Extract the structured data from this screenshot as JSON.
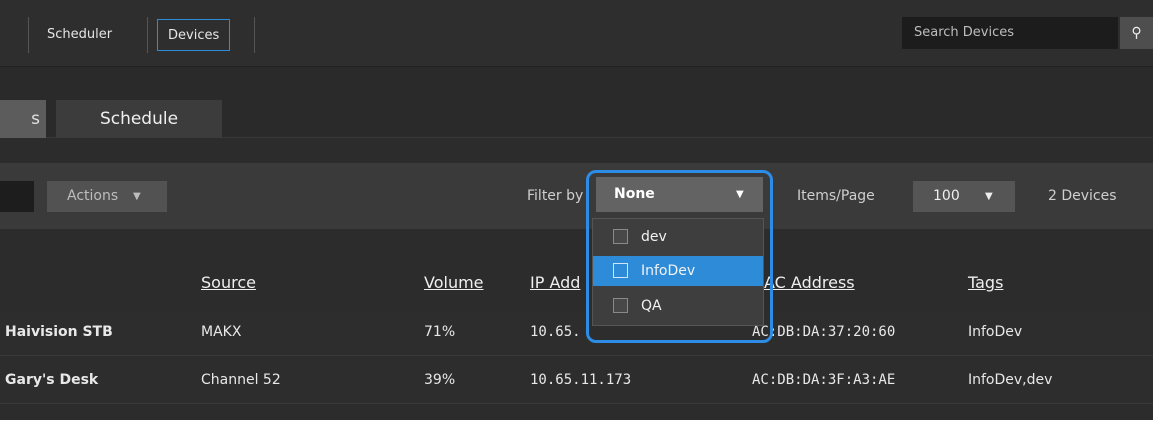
{
  "nav": {
    "tabs": [
      "Scheduler",
      "Devices"
    ],
    "active_tab": "Devices",
    "search_placeholder": "Search Devices",
    "search_icon": "search-icon"
  },
  "subtabs": {
    "left_label": "s",
    "schedule_label": "Schedule"
  },
  "toolbar": {
    "actions_label": "Actions",
    "filter_label": "Filter by",
    "filter_value": "None",
    "items_per_page_label": "Items/Page",
    "items_per_page_value": "100",
    "device_count": "2 Devices"
  },
  "filter_options": [
    {
      "label": "dev",
      "highlighted": false
    },
    {
      "label": "InfoDev",
      "highlighted": true
    },
    {
      "label": "QA",
      "highlighted": false
    }
  ],
  "table": {
    "columns": [
      "Source",
      "Volume",
      "IP Add",
      "AC Address",
      "Tags"
    ],
    "rows": [
      {
        "name": "Haivision STB",
        "source": "MAKX",
        "volume": "71%",
        "ip": "10.65.",
        "mac": "AC:DB:DA:37:20:60",
        "tags": "InfoDev"
      },
      {
        "name": "Gary's Desk",
        "source": "Channel 52",
        "volume": "39%",
        "ip": "10.65.11.173",
        "mac": "AC:DB:DA:3F:A3:AE",
        "tags": "InfoDev,dev"
      }
    ]
  },
  "colors": {
    "accent": "#2e8bd8",
    "callout": "#2c8ce6",
    "background": "#2c2c2c"
  }
}
